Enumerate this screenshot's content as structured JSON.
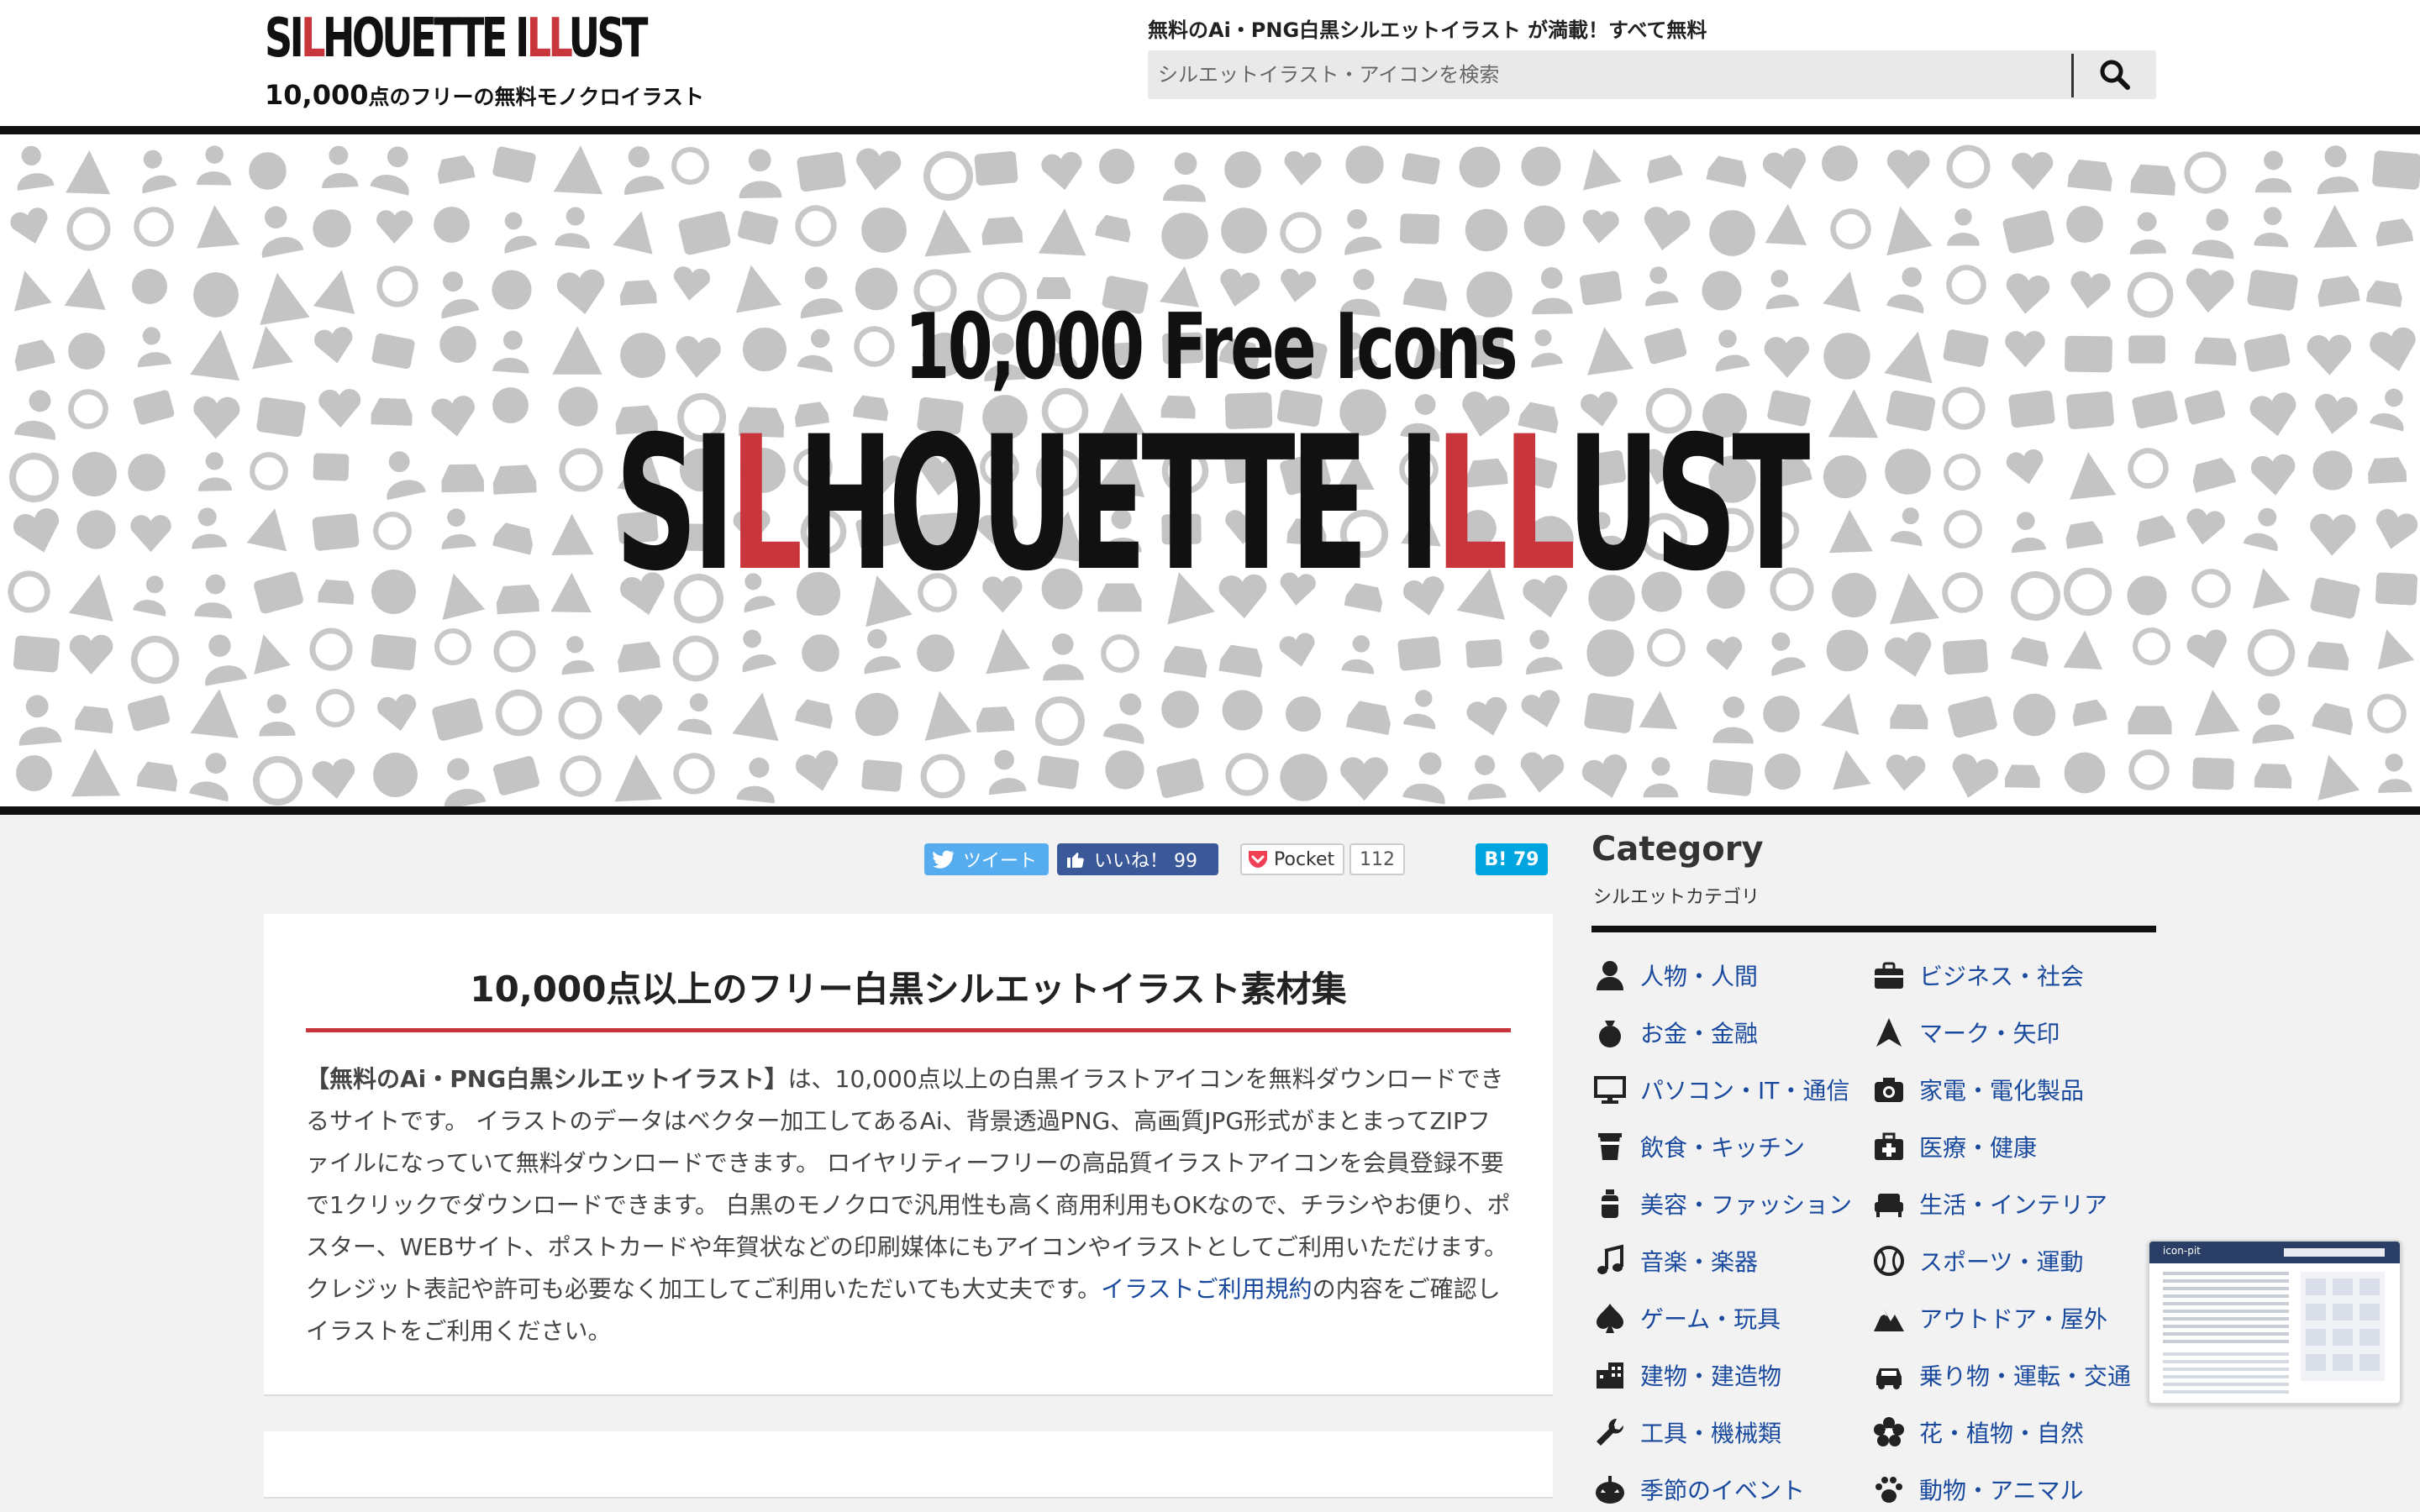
{
  "header": {
    "logo_text_pre": "SI",
    "logo_text_red": "L",
    "logo_text_mid": "HOUETTE I",
    "logo_text_red2": "LL",
    "logo_text_post": "UST",
    "logo_sub_big": "10,000",
    "logo_sub_rest": "点のフリーの無料モノクロイラスト",
    "tagline": "無料のAi・PNG白黒シルエットイラスト が満載！すべて無料",
    "search_placeholder": "シルエットイラスト・アイコンを検索"
  },
  "hero": {
    "free_icons": "10,000 Free Icons",
    "logo_pre": "SI",
    "logo_red": "L",
    "logo_mid": "HOUETTE I",
    "logo_red2": "LL",
    "logo_post": "UST"
  },
  "share": {
    "tweet": "ツイート",
    "like": "いいね！ 99",
    "pocket": "Pocket",
    "pocket_count": "112",
    "hatena": "B! 79"
  },
  "main": {
    "title": "10,000点以上のフリー白黒シルエットイラスト素材集",
    "text_strong": "【無料のAi・PNG白黒シルエットイラスト】",
    "text_body": "は、10,000点以上の白黒イラストアイコンを無料ダウンロードできるサイトです。 イラストのデータはベクター加工してあるAi、背景透過PNG、高画質JPG形式がまとまってZIPファイルになっていて無料ダウンロードできます。 ロイヤリティーフリーの高品質イラストアイコンを会員登録不要で1クリックでダウンロードできます。 白黒のモノクロで汎用性も高く商用利用もOKなので、チラシやお便り、ポスター、WEBサイト、ポストカードや年賀状などの印刷媒体にもアイコンやイラストとしてご利用いただけます。 クレジット表記や許可も必要なく加工してご利用いただいても大丈夫です。",
    "text_link": "イラストご利用規約",
    "text_end": "の内容をご確認しイラストをご利用ください。"
  },
  "sidebar": {
    "title": "Category",
    "subtitle": "シルエットカテゴリ",
    "categories": [
      {
        "label": "人物・人間",
        "icon": "person-icon"
      },
      {
        "label": "ビジネス・社会",
        "icon": "briefcase-icon"
      },
      {
        "label": "お金・金融",
        "icon": "money-bag-icon"
      },
      {
        "label": "マーク・矢印",
        "icon": "arrow-mark-icon"
      },
      {
        "label": "パソコン・IT・通信",
        "icon": "monitor-icon"
      },
      {
        "label": "家電・電化製品",
        "icon": "camera-icon"
      },
      {
        "label": "飲食・キッチン",
        "icon": "cup-icon"
      },
      {
        "label": "医療・健康",
        "icon": "medical-kit-icon"
      },
      {
        "label": "美容・ファッション",
        "icon": "bottle-icon"
      },
      {
        "label": "生活・インテリア",
        "icon": "sofa-icon"
      },
      {
        "label": "音楽・楽器",
        "icon": "music-note-icon"
      },
      {
        "label": "スポーツ・運動",
        "icon": "ball-icon"
      },
      {
        "label": "ゲーム・玩具",
        "icon": "spade-icon"
      },
      {
        "label": "アウトドア・屋外",
        "icon": "mountain-icon"
      },
      {
        "label": "建物・建造物",
        "icon": "building-icon"
      },
      {
        "label": "乗り物・運転・交通",
        "icon": "car-icon"
      },
      {
        "label": "工具・機械類",
        "icon": "wrench-icon"
      },
      {
        "label": "花・植物・自然",
        "icon": "flower-icon"
      },
      {
        "label": "季節のイベント",
        "icon": "pumpkin-icon"
      },
      {
        "label": "動物・アニマル",
        "icon": "paw-icon"
      }
    ]
  },
  "float": {
    "label": "icon-pit"
  }
}
